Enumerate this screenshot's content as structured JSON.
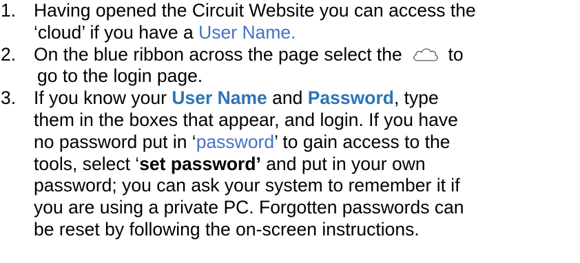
{
  "steps": [
    {
      "number": "1.",
      "lines": [
        {
          "parts": [
            {
              "text": "Having opened the Circuit Website you can access the",
              "style": "normal"
            }
          ]
        },
        {
          "parts": [
            {
              "text": "‘cloud’ if you have a ",
              "style": "normal"
            },
            {
              "text": "User Name.",
              "style": "blue"
            }
          ]
        }
      ]
    },
    {
      "number": "2.",
      "lines": [
        {
          "parts": [
            {
              "text": "On the blue ribbon across the page select  the ",
              "style": "normal"
            },
            {
              "icon": "cloud-icon"
            },
            {
              "text": " to",
              "style": "normal"
            }
          ]
        },
        {
          "indent": true,
          "parts": [
            {
              "text": "go to the login page.",
              "style": "normal"
            }
          ]
        }
      ]
    },
    {
      "number": "3.",
      "lines": [
        {
          "parts": [
            {
              "text": "If you know your ",
              "style": "normal"
            },
            {
              "text": "User Name",
              "style": "blue-bold"
            },
            {
              "text": " and ",
              "style": "normal"
            },
            {
              "text": "Password",
              "style": "blue-bold"
            },
            {
              "text": ", type",
              "style": "normal"
            }
          ]
        },
        {
          "parts": [
            {
              "text": "them in the boxes that appear, and login. If you have",
              "style": "normal"
            }
          ]
        },
        {
          "parts": [
            {
              "text": "no password put in ‘",
              "style": "normal"
            },
            {
              "text": "password",
              "style": "blue"
            },
            {
              "text": "’ to gain access to the",
              "style": "normal"
            }
          ]
        },
        {
          "parts": [
            {
              "text": "tools, select  ‘",
              "style": "normal"
            },
            {
              "text": "set password’",
              "style": "bold"
            },
            {
              "text": " and put in your own",
              "style": "normal"
            }
          ]
        },
        {
          "parts": [
            {
              "text": "password; you can ask your system to remember it if",
              "style": "normal"
            }
          ]
        },
        {
          "parts": [
            {
              "text": "you are using a private PC. Forgotten passwords can",
              "style": "normal"
            }
          ]
        },
        {
          "parts": [
            {
              "text": "be reset by following the on-screen instructions.",
              "style": "normal"
            }
          ]
        }
      ]
    }
  ],
  "colors": {
    "link_blue": "#4472c4",
    "emphasis_blue": "#2e74b5",
    "text": "#000000"
  }
}
